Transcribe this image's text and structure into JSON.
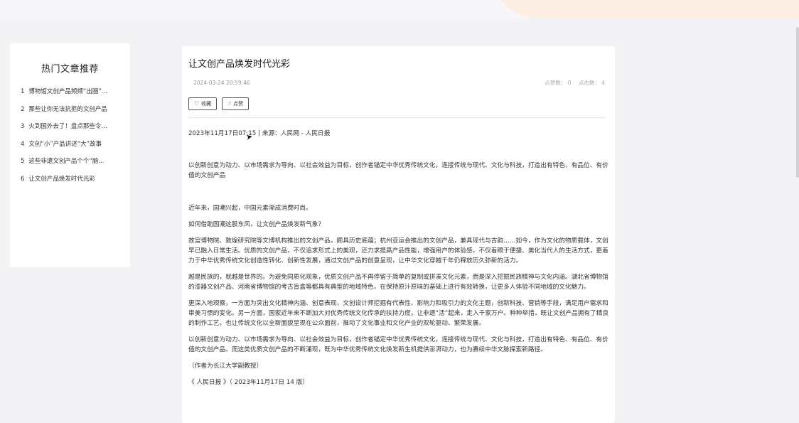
{
  "sidebar": {
    "title": "热门文章推荐",
    "items": [
      {
        "num": "1",
        "label": "博物馆文创产品频频“出圈”..."
      },
      {
        "num": "2",
        "label": "那些让你无法抗拒的文创产品"
      },
      {
        "num": "3",
        "label": "火到国外去了！盘点那些令..."
      },
      {
        "num": "4",
        "label": "文创“小”产品讲述“大”故事"
      },
      {
        "num": "5",
        "label": "这些非遗文创产品个个“脑..."
      },
      {
        "num": "6",
        "label": "让文创产品焕发时代光彩"
      }
    ]
  },
  "article": {
    "title": "让文创产品焕发时代光彩",
    "datetime": "2024-03-24 20:59:46",
    "likes": "点赞数： 0",
    "views": "点击数： 4",
    "collect_label": "收藏",
    "like_label": "点赞",
    "source_line": "2023年11月17日07:15 | 来源：人民网 - 人民日报",
    "paragraphs": [
      "以创新创意为动力、以市场需求为导向、以社会效益为目标，创作者锚定中华优秀传统文化，连接传统与现代、文化与科技，打造出有特色、有品位、有价值的文创产品",
      "近年来，国潮兴起，中国元素渐成消费时尚。",
      "如何借助国潮这股东风，让文创产品焕发新气象？",
      "故宫博物院、敦煌研究院等文博机构推出的文创产品，颇具历史底蕴；杭州亚运会推出的文创产品，兼具现代与古韵……如今，作为文化的物质载体，文创早已融入日常生活。优质的文创产品，不仅追求形式上的美观，还力求提高产品性能，增强用户的体验感。不仅着眼于便捷、美化当代人的生活方式，更着力于中华优秀传统文化创造性转化、创新性发展，通过文创产品的创意呈现，让中华文化穿越千年仍释放历久弥新的活力。",
      "越是民族的，就越是世界的。为避免同质化现象，优质文创产品不再停留于简单的复制或拼凑文化元素，而是深入挖掘民族精神与文化内涵。湖北省博物馆的漆器文创产品、河南省博物馆的考古盲盒等都具有典型的地域特色，在保持原汁原味的基础上进行有效转换，让更多人体验不同地域的文化魅力。",
      "更深入地观察，一方面为突出文化精神内涵、创意表现，文创设计师挖掘有代表性、影响力和吸引力的文化主题，创新科技、营销等手段，满足用户需求和审美习惯的变化。另一方面，国家近年来不断加大对优秀传统文化传承的扶持力度，让非遗“活”起来，走入千家万户。种种举措，既让文创产品拥有了精良的制作工艺，也让传统文化以全新面貌呈现在公众面前，推动了文化事业和文化产业的双轮驱动、繁荣发展。",
      "以创新创意为动力、以市场需求为导向、以社会效益为目标，创作者锚定中华优秀传统文化，连接传统与现代、文化与科技，打造出有特色、有品位、有价值的文创产品。而这类优质文创产品的不断涌现，既为中华优秀传统文化焕发新生机提供澎湃动力，也为赓续中华文脉探索新路径。",
      "（作者为长江大学副教授）",
      "《 人民日报 》（ 2023年11月17日 14 版）"
    ]
  },
  "icons": {
    "collect": "heart-icon",
    "like": "thumbs-up-icon",
    "cursor": "mouse-cursor-icon"
  }
}
